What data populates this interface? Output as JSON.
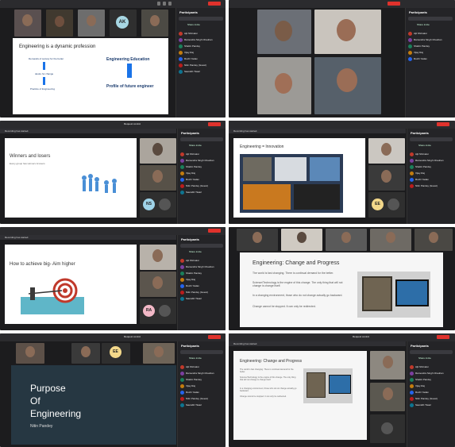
{
  "panels": [
    {
      "id": "p1",
      "slide_title": "Engineering is a dynamic profession",
      "items": [
        "Demands of society for the better",
        "desire for change",
        "Practice of Engineering"
      ],
      "right_heading": "Engineering Education",
      "right_footer": "Profile of future engineer",
      "avatar": "AK",
      "request_control": "Request control"
    },
    {
      "id": "p3",
      "slide_title": "Winners and losers",
      "subtitle": "Every group has winners & losers",
      "avatar": "NS",
      "request_control": "Request control",
      "recording": "Recording has started.",
      "sidebar_title": "Participants"
    },
    {
      "id": "p4",
      "slide_title": "Engineering = Innovation",
      "avatar": "EE",
      "recording": "Recording has started.",
      "sidebar_title": "Participants"
    },
    {
      "id": "p5",
      "slide_title": "How to achieve big- Aim higher",
      "avatar": "RA",
      "recording": "Recording has started.",
      "sidebar_title": "Participants"
    },
    {
      "id": "p6",
      "slide_title": "Engineering: Change and Progress",
      "bullets": [
        "The world is fast changing. There is continual demand for the better.",
        "Science/Technology is the engine of this change. The only thing that will not change is change itself.",
        "In a changing environment, those who do not change actually go backward.",
        "Change cannot be stopped. It can only be redirected."
      ]
    },
    {
      "id": "p7",
      "line1": "Purpose",
      "line2": "Of",
      "line3": "Engineering",
      "author": "Nitin Pandey",
      "avatar": "EE",
      "request_control": "Request control",
      "sidebar_title": "Participants"
    },
    {
      "id": "p8",
      "slide_title": "Engineering: Change and Progress",
      "recording": "Recording has started.",
      "sidebar_title": "Participants",
      "request_control": "Request control"
    }
  ],
  "sidebar": {
    "title": "Participants",
    "share_invite": "Share invite",
    "people": [
      "Ajit Shrivatsi",
      "Ramendra Singh Chauhan",
      "Shalini Pandey",
      "Vijay Raj",
      "Ruchi Yadav",
      "Nitin Pandey (Guest)",
      "Saurabh Tiwari"
    ]
  },
  "colors": {
    "dark": "#1c1c1e",
    "red": "#e0322c",
    "blue": "#1a73e8",
    "avatar_ak": "#a7d7e3",
    "avatar_ns": "#9fd3e8",
    "avatar_ra": "#f2b8c6",
    "avatar_ee": "#f3d88a"
  }
}
